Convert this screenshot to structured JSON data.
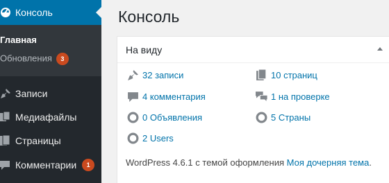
{
  "sidebar": {
    "active": {
      "label": "Консоль",
      "icon": "dashboard-icon"
    },
    "submenu": [
      {
        "label": "Главная"
      },
      {
        "label": "Обновления",
        "badge": "3"
      }
    ],
    "items": [
      {
        "label": "Записи",
        "icon": "pin-icon"
      },
      {
        "label": "Медиафайлы",
        "icon": "media-icon"
      },
      {
        "label": "Страницы",
        "icon": "page-icon"
      },
      {
        "label": "Комментарии",
        "icon": "comment-icon",
        "badge": "1"
      }
    ]
  },
  "main": {
    "title": "Консоль",
    "widget": {
      "title": "На виду",
      "stats": [
        {
          "label": "32 записи",
          "icon": "pin-icon"
        },
        {
          "label": "10 страниц",
          "icon": "pages-icon"
        },
        {
          "label": "4 комментария",
          "icon": "comment-icon"
        },
        {
          "label": "1 на проверке",
          "icon": "comments-icon"
        },
        {
          "label": "0 Объявления",
          "icon": "circle-icon"
        },
        {
          "label": "5 Страны",
          "icon": "circle-icon"
        },
        {
          "label": "2 Users",
          "icon": "circle-icon"
        }
      ],
      "footer_prefix": "WordPress 4.6.1 с темой оформления",
      "theme_link": "Моя дочерняя тема",
      "footer_suffix": "."
    }
  },
  "colors": {
    "sidebar": "#23282d",
    "submenu": "#32373c",
    "accent": "#0073aa",
    "badge": "#ca4a1f"
  }
}
